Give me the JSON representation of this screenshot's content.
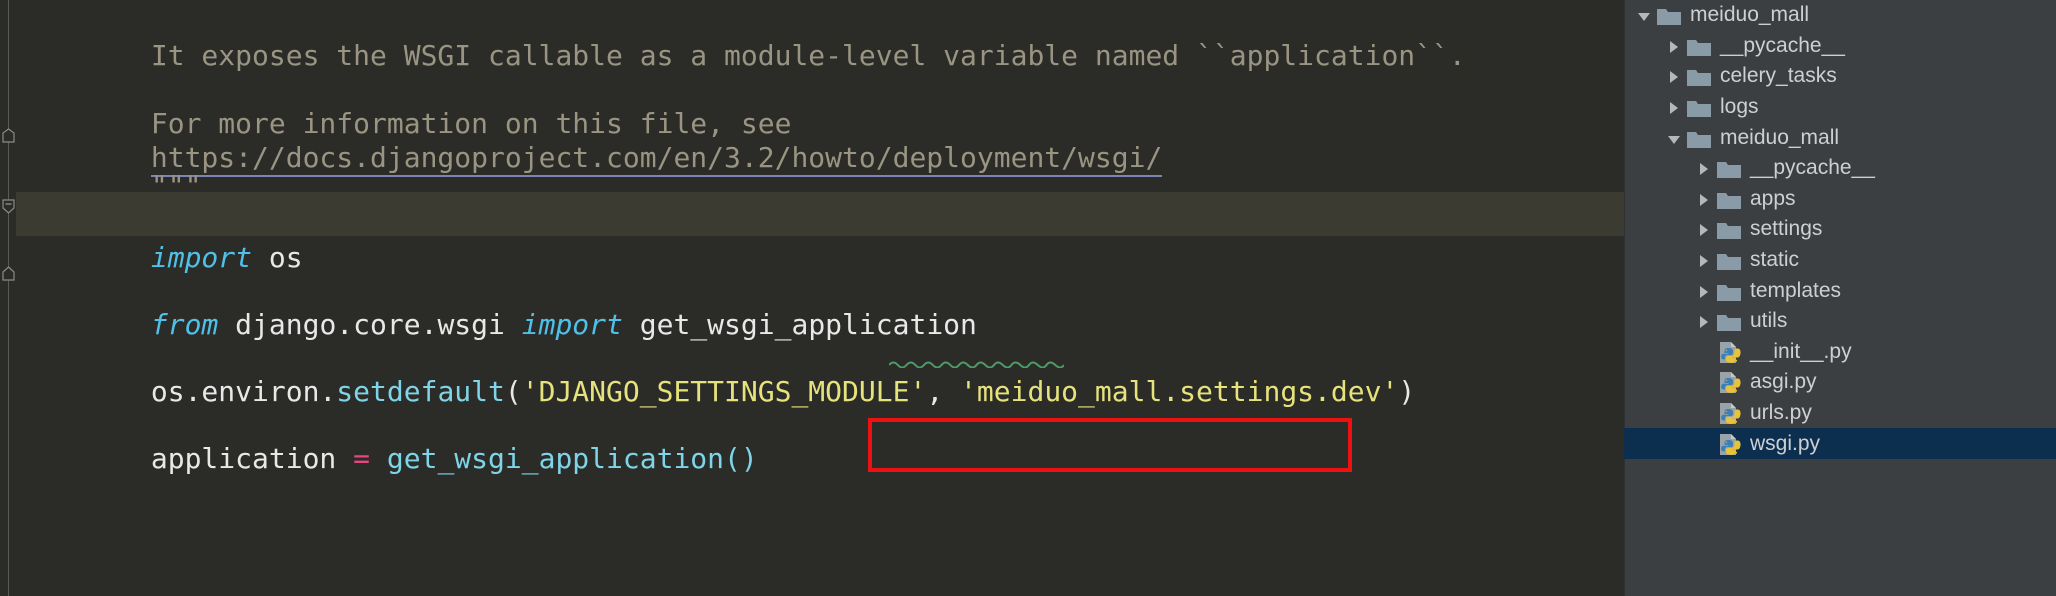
{
  "editor": {
    "file": "wsgi.py",
    "background": "#2b2b28",
    "caret_line_background": "#3b3b32",
    "lines": [
      {
        "id": "l1",
        "kind": "docstring",
        "text": "It exposes the WSGI callable as a module-level variable named ``application``."
      },
      {
        "id": "l2",
        "kind": "blank",
        "text": ""
      },
      {
        "id": "l3",
        "kind": "docstring",
        "text": "For more information on this file, see"
      },
      {
        "id": "l4",
        "kind": "url",
        "text": "https://docs.djangoproject.com/en/3.2/howto/deployment/wsgi/"
      },
      {
        "id": "l5",
        "kind": "docstring",
        "text": "\"\"\""
      },
      {
        "id": "l6",
        "kind": "blank",
        "text": ""
      },
      {
        "id": "l7",
        "kind": "import",
        "keyword": "import",
        "module": "os",
        "text": "import os"
      },
      {
        "id": "l8",
        "kind": "blank",
        "text": ""
      },
      {
        "id": "l9",
        "kind": "from-import",
        "from_kw": "from",
        "module": "django.core.wsgi",
        "import_kw": "import",
        "name": "get_wsgi_application",
        "text": "from django.core.wsgi import get_wsgi_application"
      },
      {
        "id": "l10",
        "kind": "blank",
        "text": ""
      },
      {
        "id": "l11",
        "kind": "setdefault",
        "obj": "os.environ.",
        "fn": "setdefault",
        "open_paren": "(",
        "arg1": "'DJANGO_SETTINGS_MODULE'",
        "comma": ", ",
        "arg2": "'meiduo_mall.settings.dev'",
        "close_paren": ")",
        "text": "os.environ.setdefault('DJANGO_SETTINGS_MODULE', 'meiduo_mall.settings.dev')"
      },
      {
        "id": "l12",
        "kind": "blank",
        "text": ""
      },
      {
        "id": "l13",
        "kind": "assign",
        "lhs": "application",
        "op": " = ",
        "rhs": "get_wsgi_application()",
        "text": "application = get_wsgi_application()"
      }
    ],
    "annotation": {
      "type": "red-rectangle",
      "color": "#ee1111",
      "target_text": "'meiduo_mall.settings.dev'"
    },
    "inspection_underline": {
      "type": "green-squiggle",
      "color": "#4e9a6a",
      "target_text": "meiduo_"
    },
    "colors": {
      "docstring": "#9a9582",
      "keyword": "#4fc1e9",
      "identifier": "#e8e8e8",
      "function": "#7fd4e8",
      "string": "#e6e27c",
      "operator": "#e8467f",
      "url_underline": "#7d83b5"
    }
  },
  "sidebar": {
    "background": "#3c3f41",
    "selected_background": "#0d2f4f",
    "tree": [
      {
        "label": "meiduo_mall",
        "type": "folder",
        "depth": 0,
        "state": "expanded",
        "selected": false
      },
      {
        "label": "__pycache__",
        "type": "folder",
        "depth": 1,
        "state": "collapsed",
        "selected": false
      },
      {
        "label": "celery_tasks",
        "type": "folder",
        "depth": 1,
        "state": "collapsed",
        "selected": false
      },
      {
        "label": "logs",
        "type": "folder",
        "depth": 1,
        "state": "collapsed",
        "selected": false
      },
      {
        "label": "meiduo_mall",
        "type": "folder",
        "depth": 1,
        "state": "expanded",
        "selected": false
      },
      {
        "label": "__pycache__",
        "type": "folder",
        "depth": 2,
        "state": "collapsed",
        "selected": false
      },
      {
        "label": "apps",
        "type": "folder",
        "depth": 2,
        "state": "collapsed",
        "selected": false
      },
      {
        "label": "settings",
        "type": "folder",
        "depth": 2,
        "state": "collapsed",
        "selected": false
      },
      {
        "label": "static",
        "type": "folder",
        "depth": 2,
        "state": "collapsed",
        "selected": false
      },
      {
        "label": "templates",
        "type": "folder",
        "depth": 2,
        "state": "collapsed",
        "selected": false
      },
      {
        "label": "utils",
        "type": "folder",
        "depth": 2,
        "state": "collapsed",
        "selected": false
      },
      {
        "label": "__init__.py",
        "type": "python",
        "depth": 2,
        "state": "leaf",
        "selected": false
      },
      {
        "label": "asgi.py",
        "type": "python",
        "depth": 2,
        "state": "leaf",
        "selected": false
      },
      {
        "label": "urls.py",
        "type": "python",
        "depth": 2,
        "state": "leaf",
        "selected": false
      },
      {
        "label": "wsgi.py",
        "type": "python",
        "depth": 2,
        "state": "leaf",
        "selected": true
      }
    ]
  }
}
